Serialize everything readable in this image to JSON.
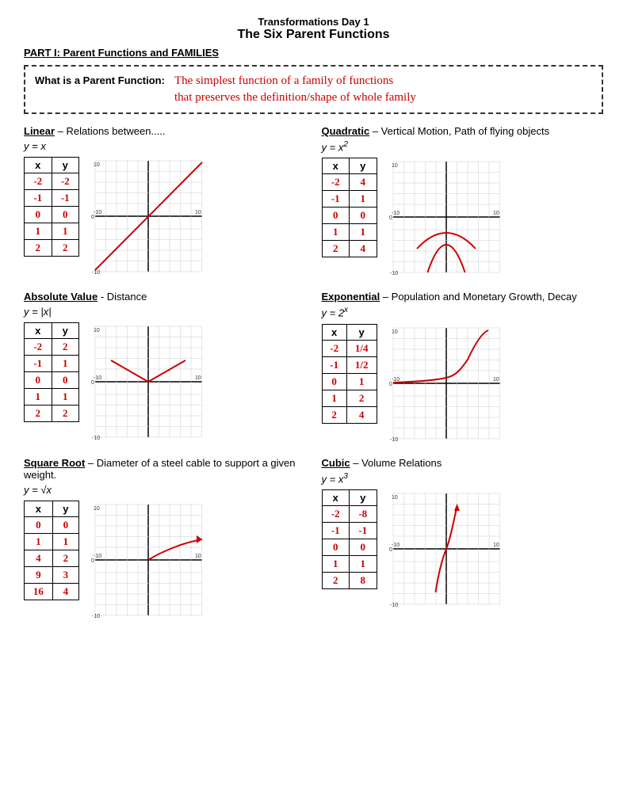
{
  "title": {
    "line1": "Transformations Day 1",
    "line2": "The Six Parent Functions"
  },
  "part1_header": "PART I: Parent Functions and FAMILIES",
  "parent_function_label": "What is a Parent Function:",
  "parent_function_answer": "The simplest function of a family of functions\nthat preserves the definition/shape of whole family",
  "functions": [
    {
      "id": "linear",
      "name": "Linear",
      "desc": "– Relations between.....",
      "equation": "y = x",
      "equation_html": "y = x",
      "table": {
        "x": [
          "-2",
          "-1",
          "0",
          "1",
          "2"
        ],
        "y": [
          "-2",
          "-1",
          "0",
          "1",
          "2"
        ]
      },
      "graph_type": "linear"
    },
    {
      "id": "quadratic",
      "name": "Quadratic",
      "desc": "– Vertical Motion, Path of flying objects",
      "equation": "y = x²",
      "equation_html": "y = x<sup>2</sup>",
      "table": {
        "x": [
          "-2",
          "-1",
          "0",
          "1",
          "2"
        ],
        "y": [
          "4",
          "1",
          "0",
          "1",
          "4"
        ]
      },
      "graph_type": "quadratic"
    },
    {
      "id": "absolute",
      "name": "Absolute Value",
      "desc": "- Distance",
      "equation": "y = |x|",
      "equation_html": "y = |x|",
      "table": {
        "x": [
          "-2",
          "-1",
          "0",
          "1",
          "2"
        ],
        "y": [
          "2",
          "1",
          "0",
          "1",
          "2"
        ]
      },
      "graph_type": "absolute"
    },
    {
      "id": "exponential",
      "name": "Exponential",
      "desc": "– Population and Monetary Growth, Decay",
      "equation": "y = 2ˣ",
      "equation_html": "y = 2<sup>x</sup>",
      "table": {
        "x": [
          "-2",
          "-1",
          "0",
          "1",
          "2"
        ],
        "y": [
          "1/4",
          "1/2",
          "1",
          "2",
          "4"
        ]
      },
      "graph_type": "exponential"
    },
    {
      "id": "squareroot",
      "name": "Square Root",
      "desc": "– Diameter of a steel cable to support a given weight.",
      "equation": "y = √x",
      "equation_html": "y = √x",
      "table": {
        "x": [
          "0",
          "1",
          "4",
          "9",
          "16"
        ],
        "y": [
          "0",
          "1",
          "2",
          "3",
          "4"
        ]
      },
      "graph_type": "squareroot"
    },
    {
      "id": "cubic",
      "name": "Cubic",
      "desc": "– Volume Relations",
      "equation": "y = x³",
      "equation_html": "y = x<sup>3</sup>",
      "table": {
        "x": [
          "-2",
          "-1",
          "0",
          "1",
          "2"
        ],
        "y": [
          "-8",
          "-1",
          "0",
          "1",
          "8"
        ]
      },
      "graph_type": "cubic"
    }
  ]
}
